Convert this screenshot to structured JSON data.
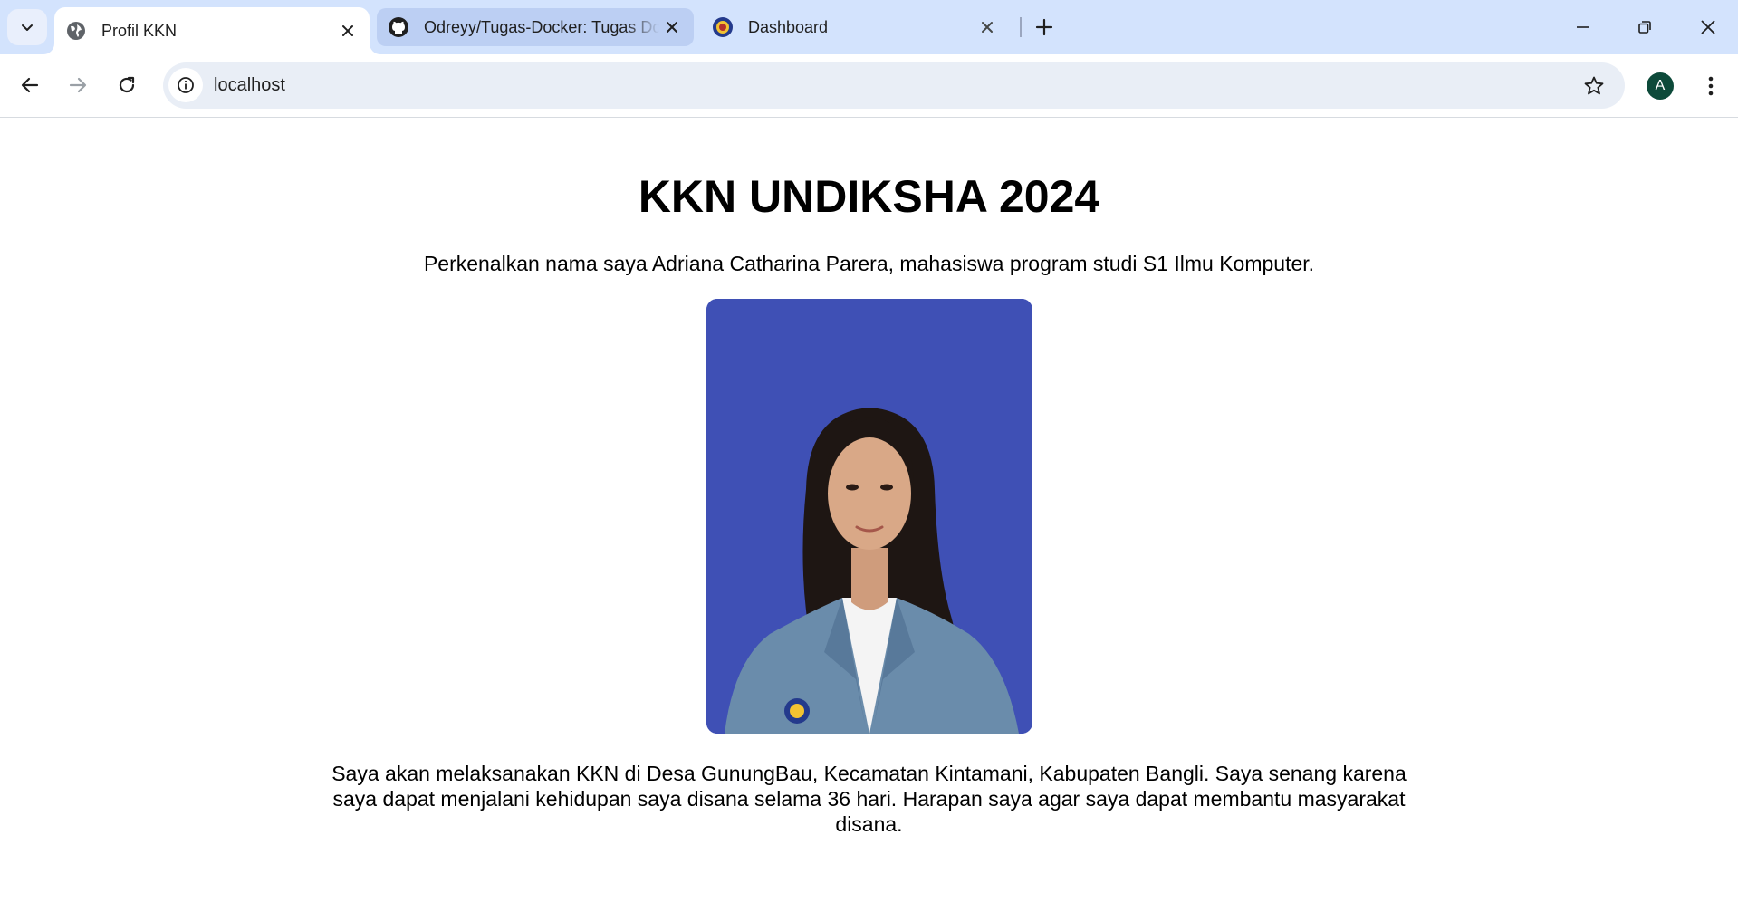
{
  "browser": {
    "tabs": [
      {
        "title": "Profil KKN",
        "favicon": "globe-icon",
        "active": true
      },
      {
        "title": "Odreyy/Tugas-Docker: Tugas Docker",
        "favicon": "github-icon",
        "active": false
      },
      {
        "title": "Dashboard",
        "favicon": "university-logo-icon",
        "active": false
      }
    ],
    "address": "localhost",
    "profile_initial": "A",
    "colors": {
      "tabstrip": "#d3e3fd",
      "omnibox": "#e9eef6",
      "avatar": "#0d4a3a"
    }
  },
  "page": {
    "title": "KKN UNDIKSHA 2024",
    "intro": "Perkenalkan nama saya Adriana Catharina Parera, mahasiswa program studi S1 Ilmu Komputer.",
    "description": "Saya akan melaksanakan KKN di Desa GunungBau, Kecamatan Kintamani, Kabupaten Bangli. Saya senang karena saya dapat menjalani kehidupan saya disana selama 36 hari. Harapan saya agar saya dapat membantu masyarakat disana.",
    "photo_background": "#3f50b5"
  }
}
